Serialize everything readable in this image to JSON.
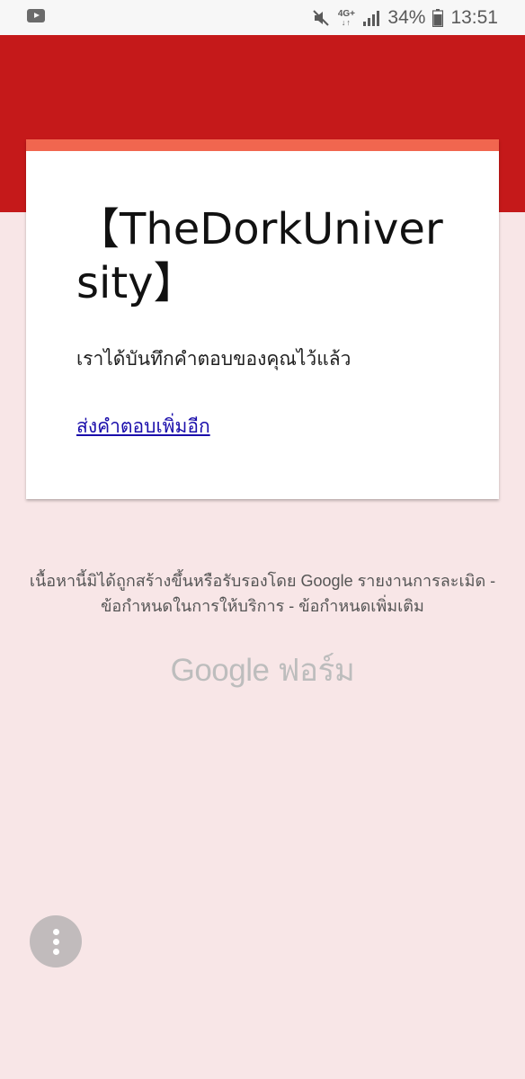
{
  "status_bar": {
    "network": "4G+",
    "battery": "34%",
    "time": "13:51",
    "icons": [
      "youtube-icon",
      "mute-icon",
      "signal-icon",
      "battery-icon"
    ]
  },
  "form": {
    "title": "【TheDorkUniversity】",
    "confirmation": "เราได้บันทึกคำตอบของคุณไว้แล้ว",
    "submit_another": "ส่งคำตอบเพิ่มอีก"
  },
  "footer": {
    "disclaimer": "เนื้อหานี้มิได้ถูกสร้างขึ้นหรือรับรองโดย Google รายงานการละเมิด - ข้อกำหนดในการให้บริการ - ข้อกำหนดเพิ่มเติม",
    "logo": "Google ฟอร์ม"
  },
  "colors": {
    "header": "#c5191a",
    "accent": "#f1664f",
    "background": "#f8e6e7",
    "link": "#1a0dab"
  }
}
